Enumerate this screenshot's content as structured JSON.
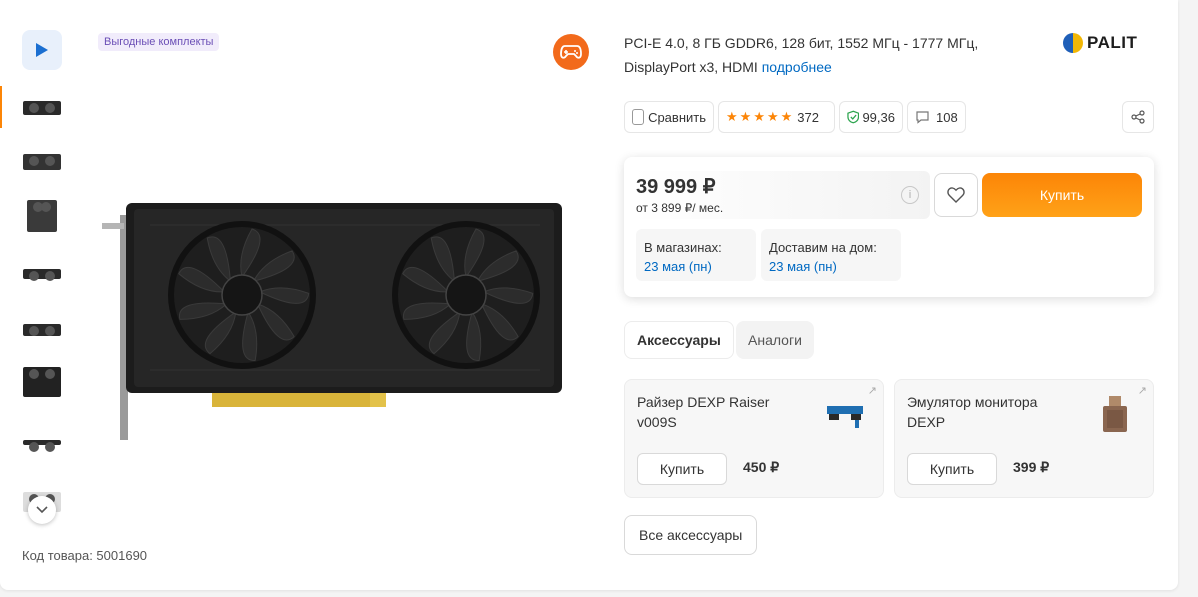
{
  "badge": {
    "kits": "Выгодные комплекты"
  },
  "sku": {
    "label": "Код товара: 5001690"
  },
  "specs": {
    "text": "PCI-E 4.0, 8 ГБ GDDR6, 128 бит, 1552 МГц - 1777 МГц, DisplayPort x3, HDMI",
    "more_link": "подробнее"
  },
  "brand": {
    "name": "PALIT"
  },
  "actions": {
    "compare": "Сравнить",
    "rating_count": "372",
    "reliability": "99,36",
    "comments": "108",
    "rating_stars": 4.5
  },
  "buybox": {
    "price": "39 999 ₽",
    "credit": "от 3 899 ₽/ мес.",
    "buy_label": "Купить",
    "store_label": "В магазинах:",
    "store_date": "23 мая (пн)",
    "home_label": "Доставим на дом:",
    "home_date": "23 мая (пн)"
  },
  "tabs": [
    {
      "label": "Аксессуары"
    },
    {
      "label": "Аналоги"
    }
  ],
  "accessories": [
    {
      "name": "Райзер DEXP Raiser v009S",
      "buy": "Купить",
      "price": "450 ₽"
    },
    {
      "name": "Эмулятор монитора DEXP",
      "buy": "Купить",
      "price": "399 ₽"
    }
  ],
  "all_accessories": "Все аксессуары",
  "colors": {
    "accent": "#fc8507",
    "link": "#0069c2",
    "badge": "#6b4fb6"
  }
}
